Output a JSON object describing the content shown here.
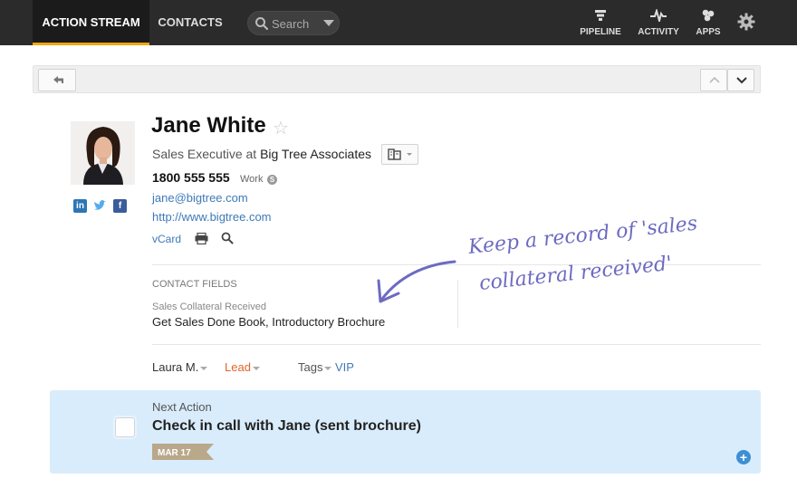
{
  "nav": {
    "tabs": [
      {
        "label": "ACTION STREAM",
        "active": true
      },
      {
        "label": "CONTACTS",
        "active": false
      }
    ],
    "search": {
      "placeholder": "Search"
    },
    "right": {
      "pipeline": "PIPELINE",
      "activity": "ACTIVITY",
      "apps": "APPS"
    }
  },
  "contact": {
    "name": "Jane White",
    "job_title": "Sales Executive at ",
    "company": "Big Tree Associates",
    "phone": "1800 555 555",
    "phone_type": "Work",
    "email": "jane@bigtree.com",
    "website": "http://www.bigtree.com",
    "vcard": "vCard"
  },
  "contact_fields": {
    "heading": "CONTACT FIELDS",
    "field_label": "Sales Collateral Received",
    "field_value": "Get Sales Done Book, Introductory Brochure"
  },
  "annotation": {
    "line1": "Keep a record of 'sales",
    "line2": "collateral received'"
  },
  "meta": {
    "owner": "Laura M.",
    "status": "Lead",
    "tags_label": "Tags",
    "tag": "VIP"
  },
  "next_action": {
    "label": "Next Action",
    "title": "Check in call with Jane (sent brochure)",
    "date": "MAR 17"
  },
  "colors": {
    "nav_bg": "#2b2b2b",
    "active_underline": "#f2a70f",
    "link": "#3d7ab8",
    "lead": "#e0662a",
    "next_action_bg": "#d9ecfb",
    "annotation": "#6c6bc2",
    "date_tag": "#b9a88a"
  }
}
